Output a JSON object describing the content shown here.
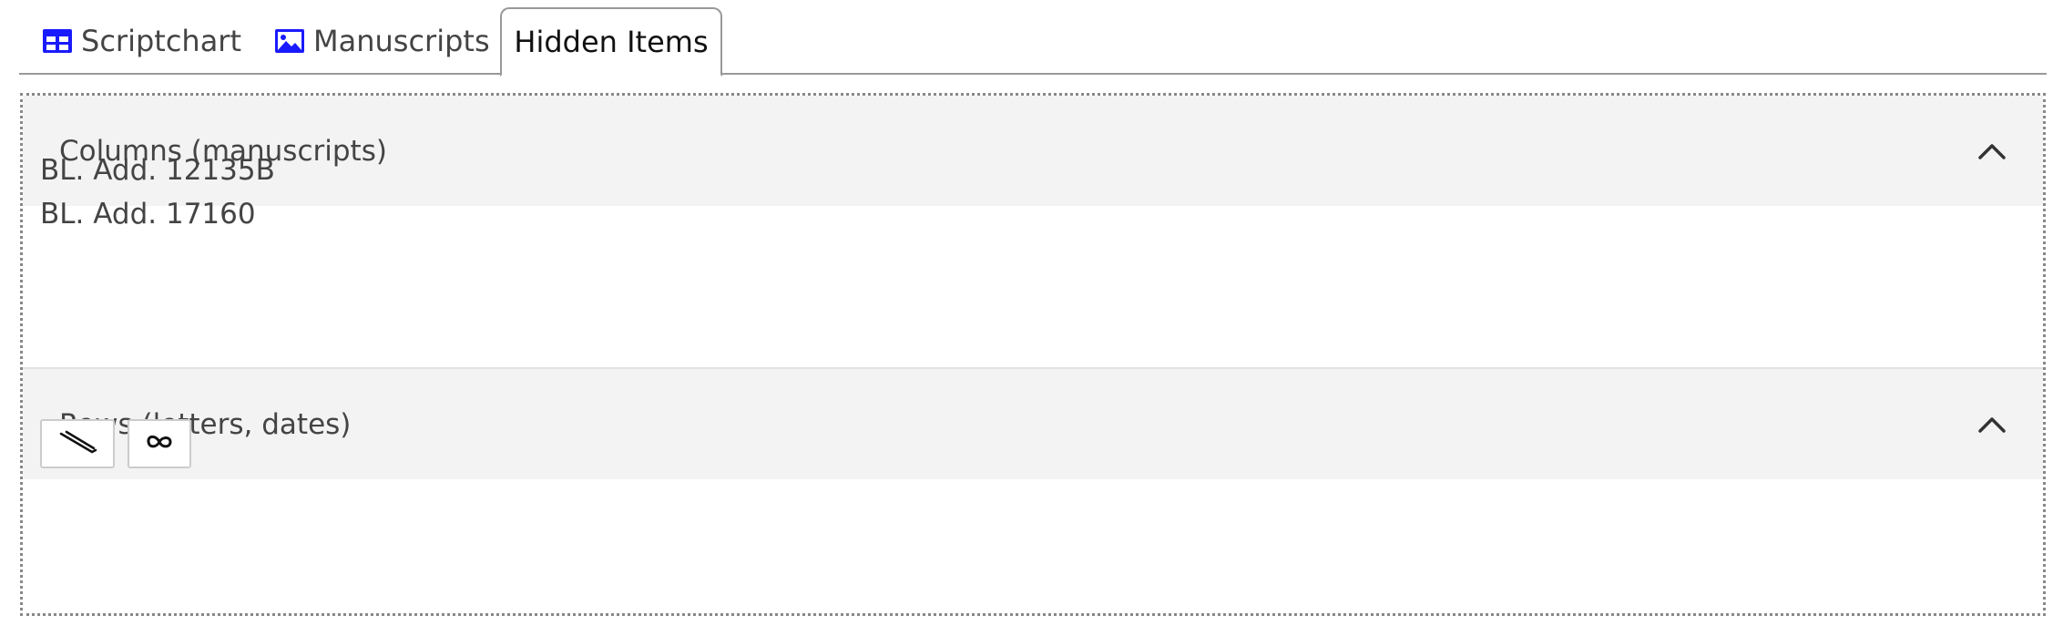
{
  "tabs": [
    {
      "label": "Scriptchart",
      "icon": "table-icon",
      "active": false
    },
    {
      "label": "Manuscripts",
      "icon": "image-icon",
      "active": false
    },
    {
      "label": "Hidden Items",
      "icon": null,
      "active": true
    }
  ],
  "colors": {
    "icon_blue": "#1a1aff",
    "header_bg": "#f3f3f3",
    "text": "#444444",
    "border": "#999999"
  },
  "columns_section": {
    "title": "Columns (manuscripts)",
    "toggle_icon": "chevron-up-icon",
    "items": [
      "BL. Add. 12135B",
      "BL. Add. 17160"
    ]
  },
  "rows_section": {
    "title": "Rows (letters, dates)",
    "toggle_icon": "chevron-up-icon",
    "letters": [
      {
        "glyph_name": "slanted-strokes-glyph"
      },
      {
        "glyph_name": "loop-glyph"
      }
    ]
  }
}
